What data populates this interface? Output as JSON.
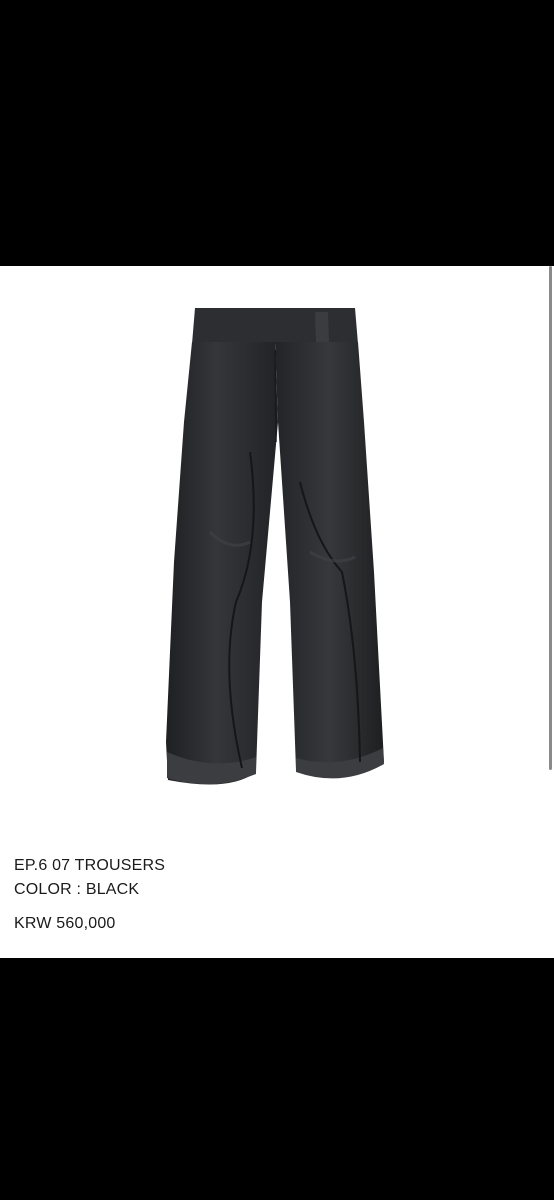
{
  "product": {
    "name": "EP.6 07 TROUSERS",
    "color": "COLOR : BLACK",
    "price": "KRW 560,000",
    "image_icon": "trousers-photo"
  },
  "colors": {
    "letterbox": "#000000",
    "background": "#ffffff",
    "text": "#1a1a1a",
    "garment": "#2a2b2d"
  }
}
